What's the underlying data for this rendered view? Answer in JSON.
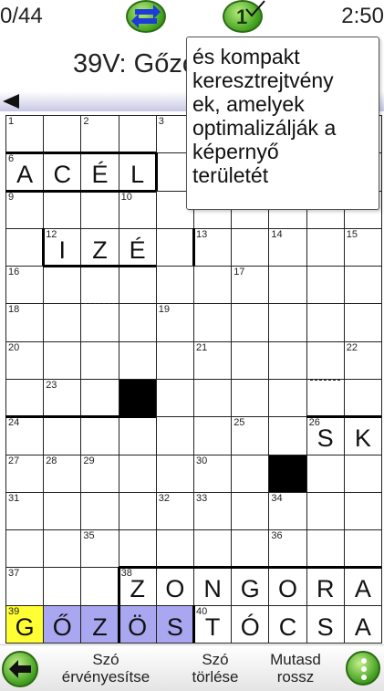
{
  "header": {
    "score": "0/44",
    "timer": "2:50",
    "hint_count": "1"
  },
  "clue": {
    "text": "39V: Gőzös"
  },
  "tooltip": {
    "lines": [
      "és kompakt",
      "keresztrejtvény",
      "ek, amelyek",
      "optimalizálják a",
      "képernyő",
      "területét"
    ]
  },
  "grid": {
    "rows": 14,
    "cols": 10,
    "black_cells": [
      [
        8,
        3
      ],
      [
        10,
        7
      ],
      [
        14,
        3
      ]
    ],
    "cells": [
      {
        "r": 1,
        "c": 0,
        "num": "1",
        "letter": ""
      },
      {
        "r": 1,
        "c": 2,
        "num": "2",
        "letter": ""
      },
      {
        "r": 1,
        "c": 4,
        "num": "3",
        "letter": ""
      },
      {
        "r": 2,
        "c": 0,
        "num": "6",
        "letter": "A"
      },
      {
        "r": 2,
        "c": 1,
        "num": "",
        "letter": "C"
      },
      {
        "r": 2,
        "c": 2,
        "num": "",
        "letter": "É"
      },
      {
        "r": 2,
        "c": 3,
        "num": "",
        "letter": "L"
      },
      {
        "r": 3,
        "c": 0,
        "num": "9",
        "letter": ""
      },
      {
        "r": 3,
        "c": 3,
        "num": "10",
        "letter": ""
      },
      {
        "r": 4,
        "c": 1,
        "num": "12",
        "letter": "I"
      },
      {
        "r": 4,
        "c": 2,
        "num": "",
        "letter": "Z"
      },
      {
        "r": 4,
        "c": 3,
        "num": "",
        "letter": "É"
      },
      {
        "r": 4,
        "c": 5,
        "num": "13",
        "letter": ""
      },
      {
        "r": 4,
        "c": 7,
        "num": "14",
        "letter": ""
      },
      {
        "r": 4,
        "c": 9,
        "num": "15",
        "letter": ""
      },
      {
        "r": 5,
        "c": 0,
        "num": "16",
        "letter": ""
      },
      {
        "r": 5,
        "c": 6,
        "num": "17",
        "letter": ""
      },
      {
        "r": 6,
        "c": 0,
        "num": "18",
        "letter": ""
      },
      {
        "r": 6,
        "c": 4,
        "num": "19",
        "letter": ""
      },
      {
        "r": 7,
        "c": 0,
        "num": "20",
        "letter": ""
      },
      {
        "r": 7,
        "c": 5,
        "num": "21",
        "letter": ""
      },
      {
        "r": 7,
        "c": 9,
        "num": "22",
        "letter": ""
      },
      {
        "r": 8,
        "c": 1,
        "num": "23",
        "letter": ""
      },
      {
        "r": 9,
        "c": 0,
        "num": "24",
        "letter": ""
      },
      {
        "r": 9,
        "c": 6,
        "num": "25",
        "letter": ""
      },
      {
        "r": 9,
        "c": 8,
        "num": "26",
        "letter": "S"
      },
      {
        "r": 9,
        "c": 9,
        "num": "",
        "letter": "K"
      },
      {
        "r": 10,
        "c": 0,
        "num": "27",
        "letter": ""
      },
      {
        "r": 10,
        "c": 1,
        "num": "28",
        "letter": ""
      },
      {
        "r": 10,
        "c": 2,
        "num": "29",
        "letter": ""
      },
      {
        "r": 10,
        "c": 5,
        "num": "30",
        "letter": ""
      },
      {
        "r": 11,
        "c": 0,
        "num": "31",
        "letter": ""
      },
      {
        "r": 11,
        "c": 4,
        "num": "32",
        "letter": ""
      },
      {
        "r": 11,
        "c": 5,
        "num": "33",
        "letter": ""
      },
      {
        "r": 11,
        "c": 7,
        "num": "34",
        "letter": ""
      },
      {
        "r": 12,
        "c": 2,
        "num": "35",
        "letter": ""
      },
      {
        "r": 12,
        "c": 7,
        "num": "36",
        "letter": ""
      },
      {
        "r": 13,
        "c": 0,
        "num": "37",
        "letter": ""
      },
      {
        "r": 13,
        "c": 3,
        "num": "38",
        "letter": "Z"
      },
      {
        "r": 13,
        "c": 4,
        "num": "",
        "letter": "O"
      },
      {
        "r": 13,
        "c": 5,
        "num": "",
        "letter": "N"
      },
      {
        "r": 13,
        "c": 6,
        "num": "",
        "letter": "G"
      },
      {
        "r": 13,
        "c": 7,
        "num": "",
        "letter": "O"
      },
      {
        "r": 13,
        "c": 8,
        "num": "",
        "letter": "R"
      },
      {
        "r": 13,
        "c": 9,
        "num": "",
        "letter": "A"
      },
      {
        "r": 14,
        "c": 0,
        "num": "39",
        "letter": "G",
        "hl": "yellow"
      },
      {
        "r": 14,
        "c": 1,
        "num": "",
        "letter": "Ő",
        "hl": "blue"
      },
      {
        "r": 14,
        "c": 2,
        "num": "",
        "letter": "Z",
        "hl": "blue"
      },
      {
        "r": 14,
        "c": 3,
        "num": "",
        "letter": "Ö",
        "hl": "blue"
      },
      {
        "r": 14,
        "c": 4,
        "num": "",
        "letter": "S",
        "hl": "blue"
      },
      {
        "r": 14,
        "c": 5,
        "num": "40",
        "letter": "T"
      },
      {
        "r": 14,
        "c": 6,
        "num": "",
        "letter": "Ó"
      },
      {
        "r": 14,
        "c": 7,
        "num": "",
        "letter": "C"
      },
      {
        "r": 14,
        "c": 8,
        "num": "",
        "letter": "S"
      },
      {
        "r": 14,
        "c": 9,
        "num": "",
        "letter": "A"
      }
    ]
  },
  "toolbar": {
    "validate_label": [
      "Szó",
      "érvényesítse"
    ],
    "delete_label": [
      "Szó",
      "törlése"
    ],
    "show_wrong_label": [
      "Mutasd",
      "rossz"
    ]
  },
  "colors": {
    "accent_green": "#3d9f1b",
    "highlight_yellow": "#ffff33",
    "highlight_blue": "#a9a7f0"
  }
}
